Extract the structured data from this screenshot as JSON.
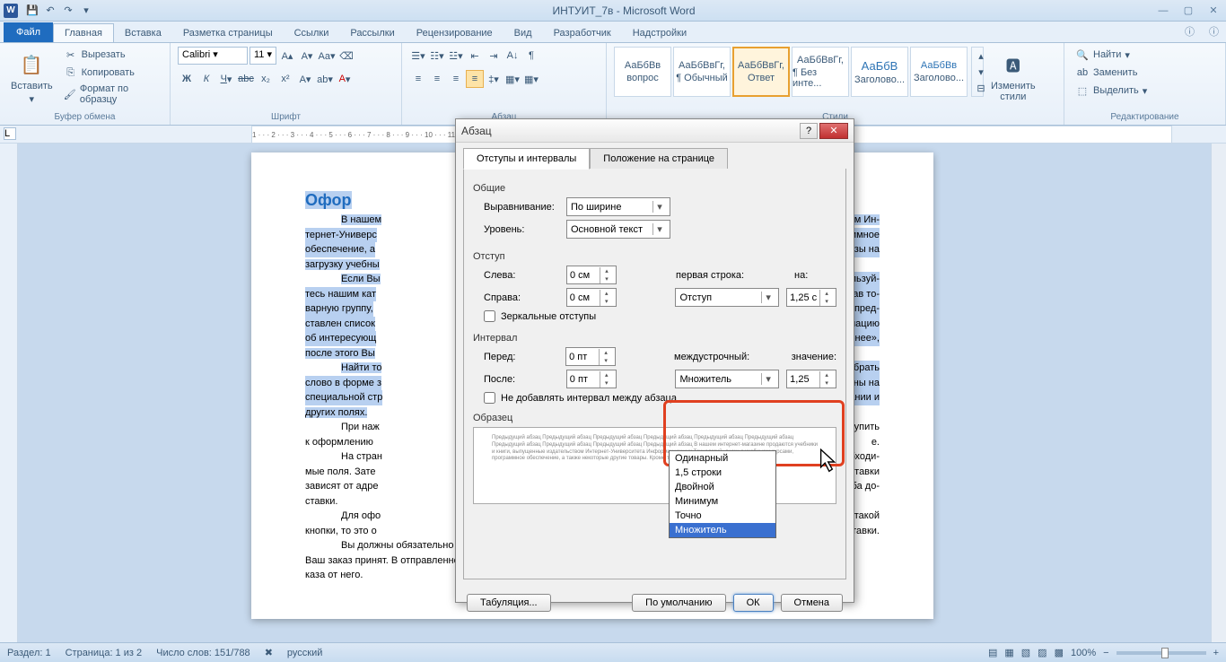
{
  "title": "ИНТУИТ_7в - Microsoft Word",
  "tabs": {
    "file": "Файл",
    "home": "Главная",
    "insert": "Вставка",
    "layout": "Разметка страницы",
    "refs": "Ссылки",
    "mail": "Рассылки",
    "review": "Рецензирование",
    "view": "Вид",
    "dev": "Разработчик",
    "addins": "Надстройки"
  },
  "clipboard": {
    "label": "Буфер обмена",
    "paste": "Вставить",
    "cut": "Вырезать",
    "copy": "Копировать",
    "format": "Формат по образцу"
  },
  "font": {
    "label": "Шрифт",
    "name": "Calibri",
    "size": "11"
  },
  "para": {
    "label": "Абзац"
  },
  "styles": {
    "label": "Стили",
    "items": [
      "АаБбВв",
      "АаБбВвГг,",
      "АаБбВвГг,",
      "АаБбВвГг,",
      "АаБбВ",
      "АаБбВв"
    ],
    "names": [
      "вопрос",
      "¶ Обычный",
      "Ответ",
      "¶ Без инте...",
      "Заголово...",
      "Заголово..."
    ],
    "change": "Изменить\nстили"
  },
  "editing": {
    "label": "Редактирование",
    "find": "Найти",
    "replace": "Заменить",
    "select": "Выделить"
  },
  "ruler": "1 · · · 2 · · · 3 · · · 4 · · · 5 · · · 6 · · · 7 · · · 8 · · · 9 · · · 10 · · · 11 · · · 12 · · · 13 · · · 14 · · · 15 · · · 16 · · · 17",
  "doc": {
    "title": "Офор",
    "p1": "В нашем",
    "p2": "тернет-Универс",
    "p3": "обеспечение, а",
    "p4": "загрузку учебны",
    "p5": "Если Вы",
    "p6": "тесь нашим кат",
    "p7": "варную группу,",
    "p8": "ставлен список",
    "p9": "об интересующ",
    "p10": "после этого Вы",
    "p11": "Найти то",
    "p12": "слово в форме з",
    "p13": "специальной стр",
    "p14": "других полях.",
    "p15": "При наж",
    "p16": "к оформлению",
    "p17": "На стран",
    "p18": "мые поля. Зате",
    "p19": "зависят от адре",
    "p20": "ставки.",
    "p21": "Для офо",
    "p22": "кнопки, то это о",
    "r1": "ьством Ин-",
    "r2": "рограммное",
    "r3": "ь заказы на",
    "r4": "оспользуй-",
    "r5": "Выбрав то-",
    "r6": "алога пред-",
    "r7": "формацию",
    "r8": "дробнее»,",
    "r9": "мо набрать",
    "r10": "ражены на",
    "r11": "названии и",
    "r12": "риступить",
    "r13": "е.",
    "r14": "необходи-",
    "r15": "ы доставки",
    "r16": "пособа до-",
    "r17": "е нет такой",
    "r18": "оставки.",
    "b1": "Вы должны обязательно получить от нас подтверждение по электронной почте о том, что",
    "b2": "Ваш заказ принят. В отправленном письме будут ссылки для подтверждения Вами заказа или от-",
    "b3": "каза от него."
  },
  "dialog": {
    "title": "Абзац",
    "tab1": "Отступы и интервалы",
    "tab2": "Положение на странице",
    "general": "Общие",
    "align": "Выравнивание:",
    "align_val": "По ширине",
    "level": "Уровень:",
    "level_val": "Основной текст",
    "indent": "Отступ",
    "left": "Слева:",
    "left_val": "0 см",
    "right": "Справа:",
    "right_val": "0 см",
    "firstline": "первая строка:",
    "firstline_val": "Отступ",
    "by": "на:",
    "by_val": "1,25 см",
    "mirror": "Зеркальные отступы",
    "spacing": "Интервал",
    "before": "Перед:",
    "before_val": "0 пт",
    "after": "После:",
    "after_val": "0 пт",
    "linespace": "междустрочный:",
    "linespace_val": "Множитель",
    "value": "значение:",
    "value_val": "1,25",
    "noadd": "Не добавлять интервал между абзаца",
    "sample": "Образец",
    "sample_text": "Предыдущий абзац Предыдущий абзац Предыдущий абзац Предыдущий абзац Предыдущий абзац Предыдущий абзац Предыдущий абзац Предыдущий абзац Предыдущий абзац Предыдущий абзац\n\nВ нашем интернет-магазине продаются учебники и книги, выпущенные издательством Интернет-Университета Информационных Технологий, диски с учебными курсами, программное обеспечение, а также некоторые другие товары. Кроме того, в нем можно оформить заказы на",
    "tabs_btn": "Табуляция...",
    "default_btn": "По умолчанию",
    "ok": "ОК",
    "cancel": "Отмена",
    "dropdown": [
      "Одинарный",
      "1,5 строки",
      "Двойной",
      "Минимум",
      "Точно",
      "Множитель"
    ]
  },
  "status": {
    "section": "Раздел: 1",
    "page": "Страница: 1 из 2",
    "words": "Число слов: 151/788",
    "lang": "русский",
    "zoom": "100%"
  }
}
